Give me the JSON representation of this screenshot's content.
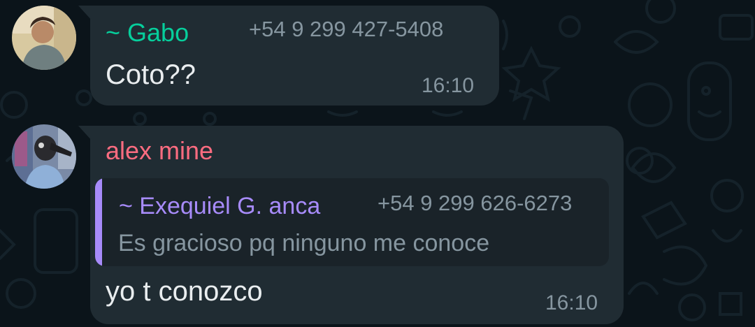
{
  "colors": {
    "background": "#0b141a",
    "bubble": "#202c33",
    "quote_bg": "#1a2329",
    "text_primary": "#e9edef",
    "text_secondary": "#8696a0",
    "gabo_name": "#06cf9c",
    "alex_name": "#fc6c80",
    "quoted_name": "#a78bfa"
  },
  "messages": [
    {
      "sender": "~ Gabo",
      "phone": "+54 9 299 427-5408",
      "text": "Coto??",
      "time": "16:10",
      "avatar_icon": "contact-photo-icon"
    },
    {
      "sender": "alex mine",
      "text": "yo t conozco",
      "time": "16:10",
      "avatar_icon": "contact-photo-icon",
      "quote": {
        "sender": "~ Exequiel G. anca",
        "phone": "+54 9 299 626-6273",
        "text": "Es gracioso pq ninguno me conoce"
      }
    }
  ]
}
